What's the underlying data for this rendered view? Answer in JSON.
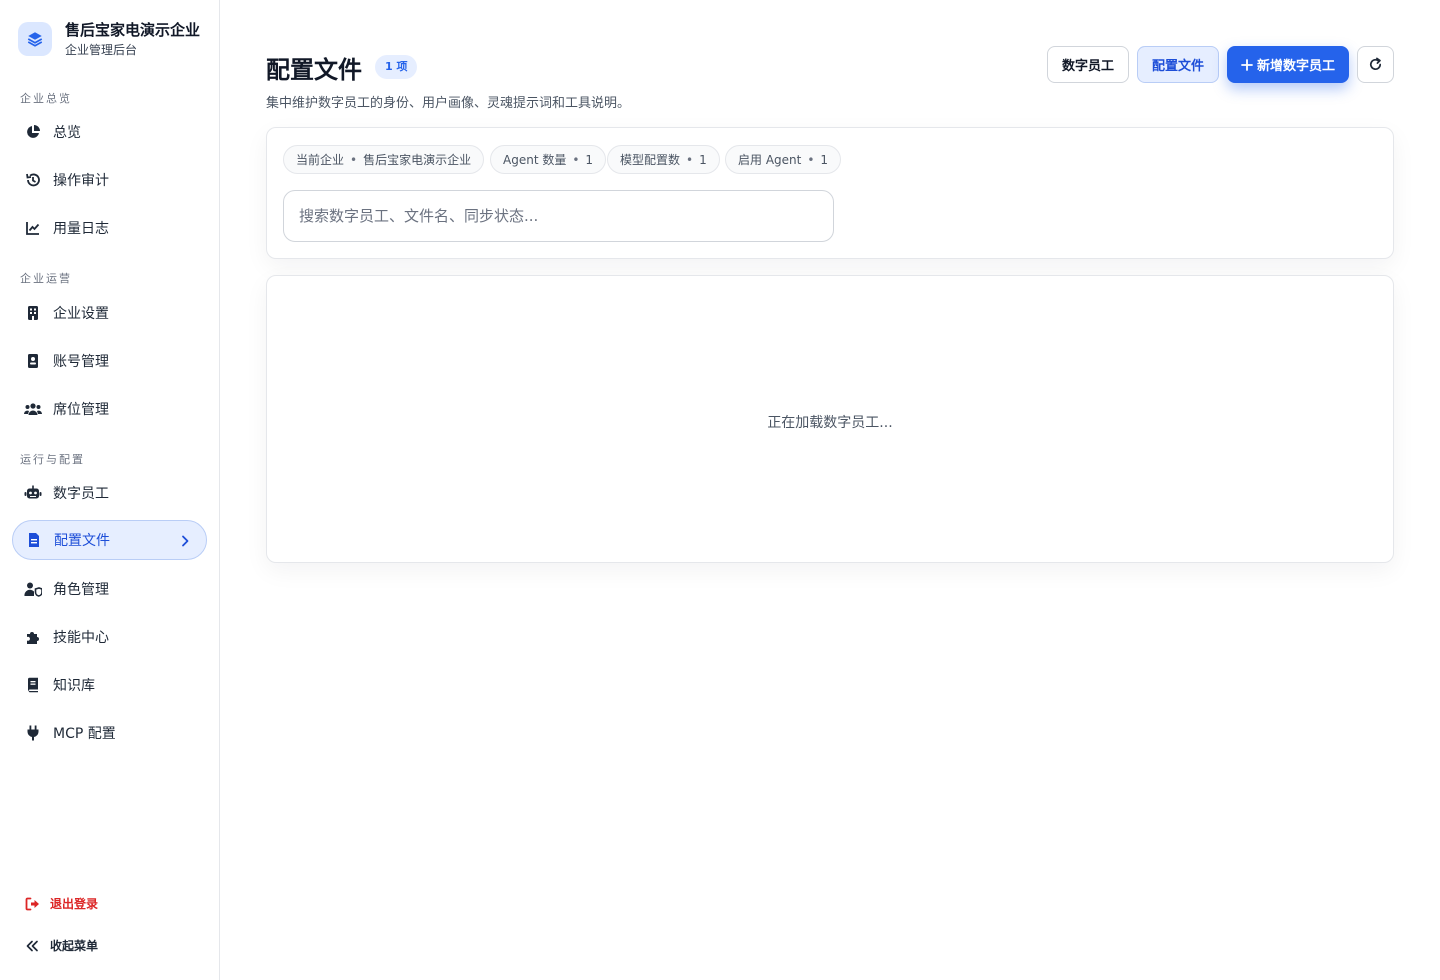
{
  "brand": {
    "name": "售后宝家电演示企业",
    "subtitle": "企业管理后台"
  },
  "sidebar": {
    "sections": [
      {
        "label": "企业总览"
      },
      {
        "label": "企业运营"
      },
      {
        "label": "运行与配置"
      }
    ],
    "items": [
      {
        "label": "总览",
        "icon": "pie-chart-icon"
      },
      {
        "label": "操作审计",
        "icon": "history-icon"
      },
      {
        "label": "用量日志",
        "icon": "line-chart-icon"
      },
      {
        "label": "企业设置",
        "icon": "building-icon"
      },
      {
        "label": "账号管理",
        "icon": "id-card-icon"
      },
      {
        "label": "席位管理",
        "icon": "users-icon"
      },
      {
        "label": "数字员工",
        "icon": "robot-icon"
      },
      {
        "label": "配置文件",
        "icon": "file-icon",
        "active": true
      },
      {
        "label": "角色管理",
        "icon": "user-shield-icon"
      },
      {
        "label": "技能中心",
        "icon": "puzzle-icon"
      },
      {
        "label": "知识库",
        "icon": "book-icon"
      },
      {
        "label": "MCP 配置",
        "icon": "plug-icon"
      }
    ],
    "logout": "退出登录",
    "collapse": "收起菜单"
  },
  "header": {
    "title": "配置文件",
    "count_badge": "1 项",
    "description": "集中维护数字员工的身份、用户画像、灵魂提示词和工具说明。",
    "buttons": {
      "employees": "数字员工",
      "config": "配置文件",
      "add": "新增数字员工"
    }
  },
  "filters": {
    "chips": [
      {
        "label": "当前企业",
        "value": "售后宝家电演示企业"
      },
      {
        "label": "Agent 数量",
        "value": "1"
      },
      {
        "label": "模型配置数",
        "value": "1"
      },
      {
        "label": "启用 Agent",
        "value": "1"
      }
    ],
    "search_placeholder": "搜索数字员工、文件名、同步状态..."
  },
  "content": {
    "loading": "正在加载数字员工..."
  },
  "colors": {
    "accent": "#2563eb",
    "active_bg": "#e6eeff",
    "danger": "#dc2626"
  }
}
